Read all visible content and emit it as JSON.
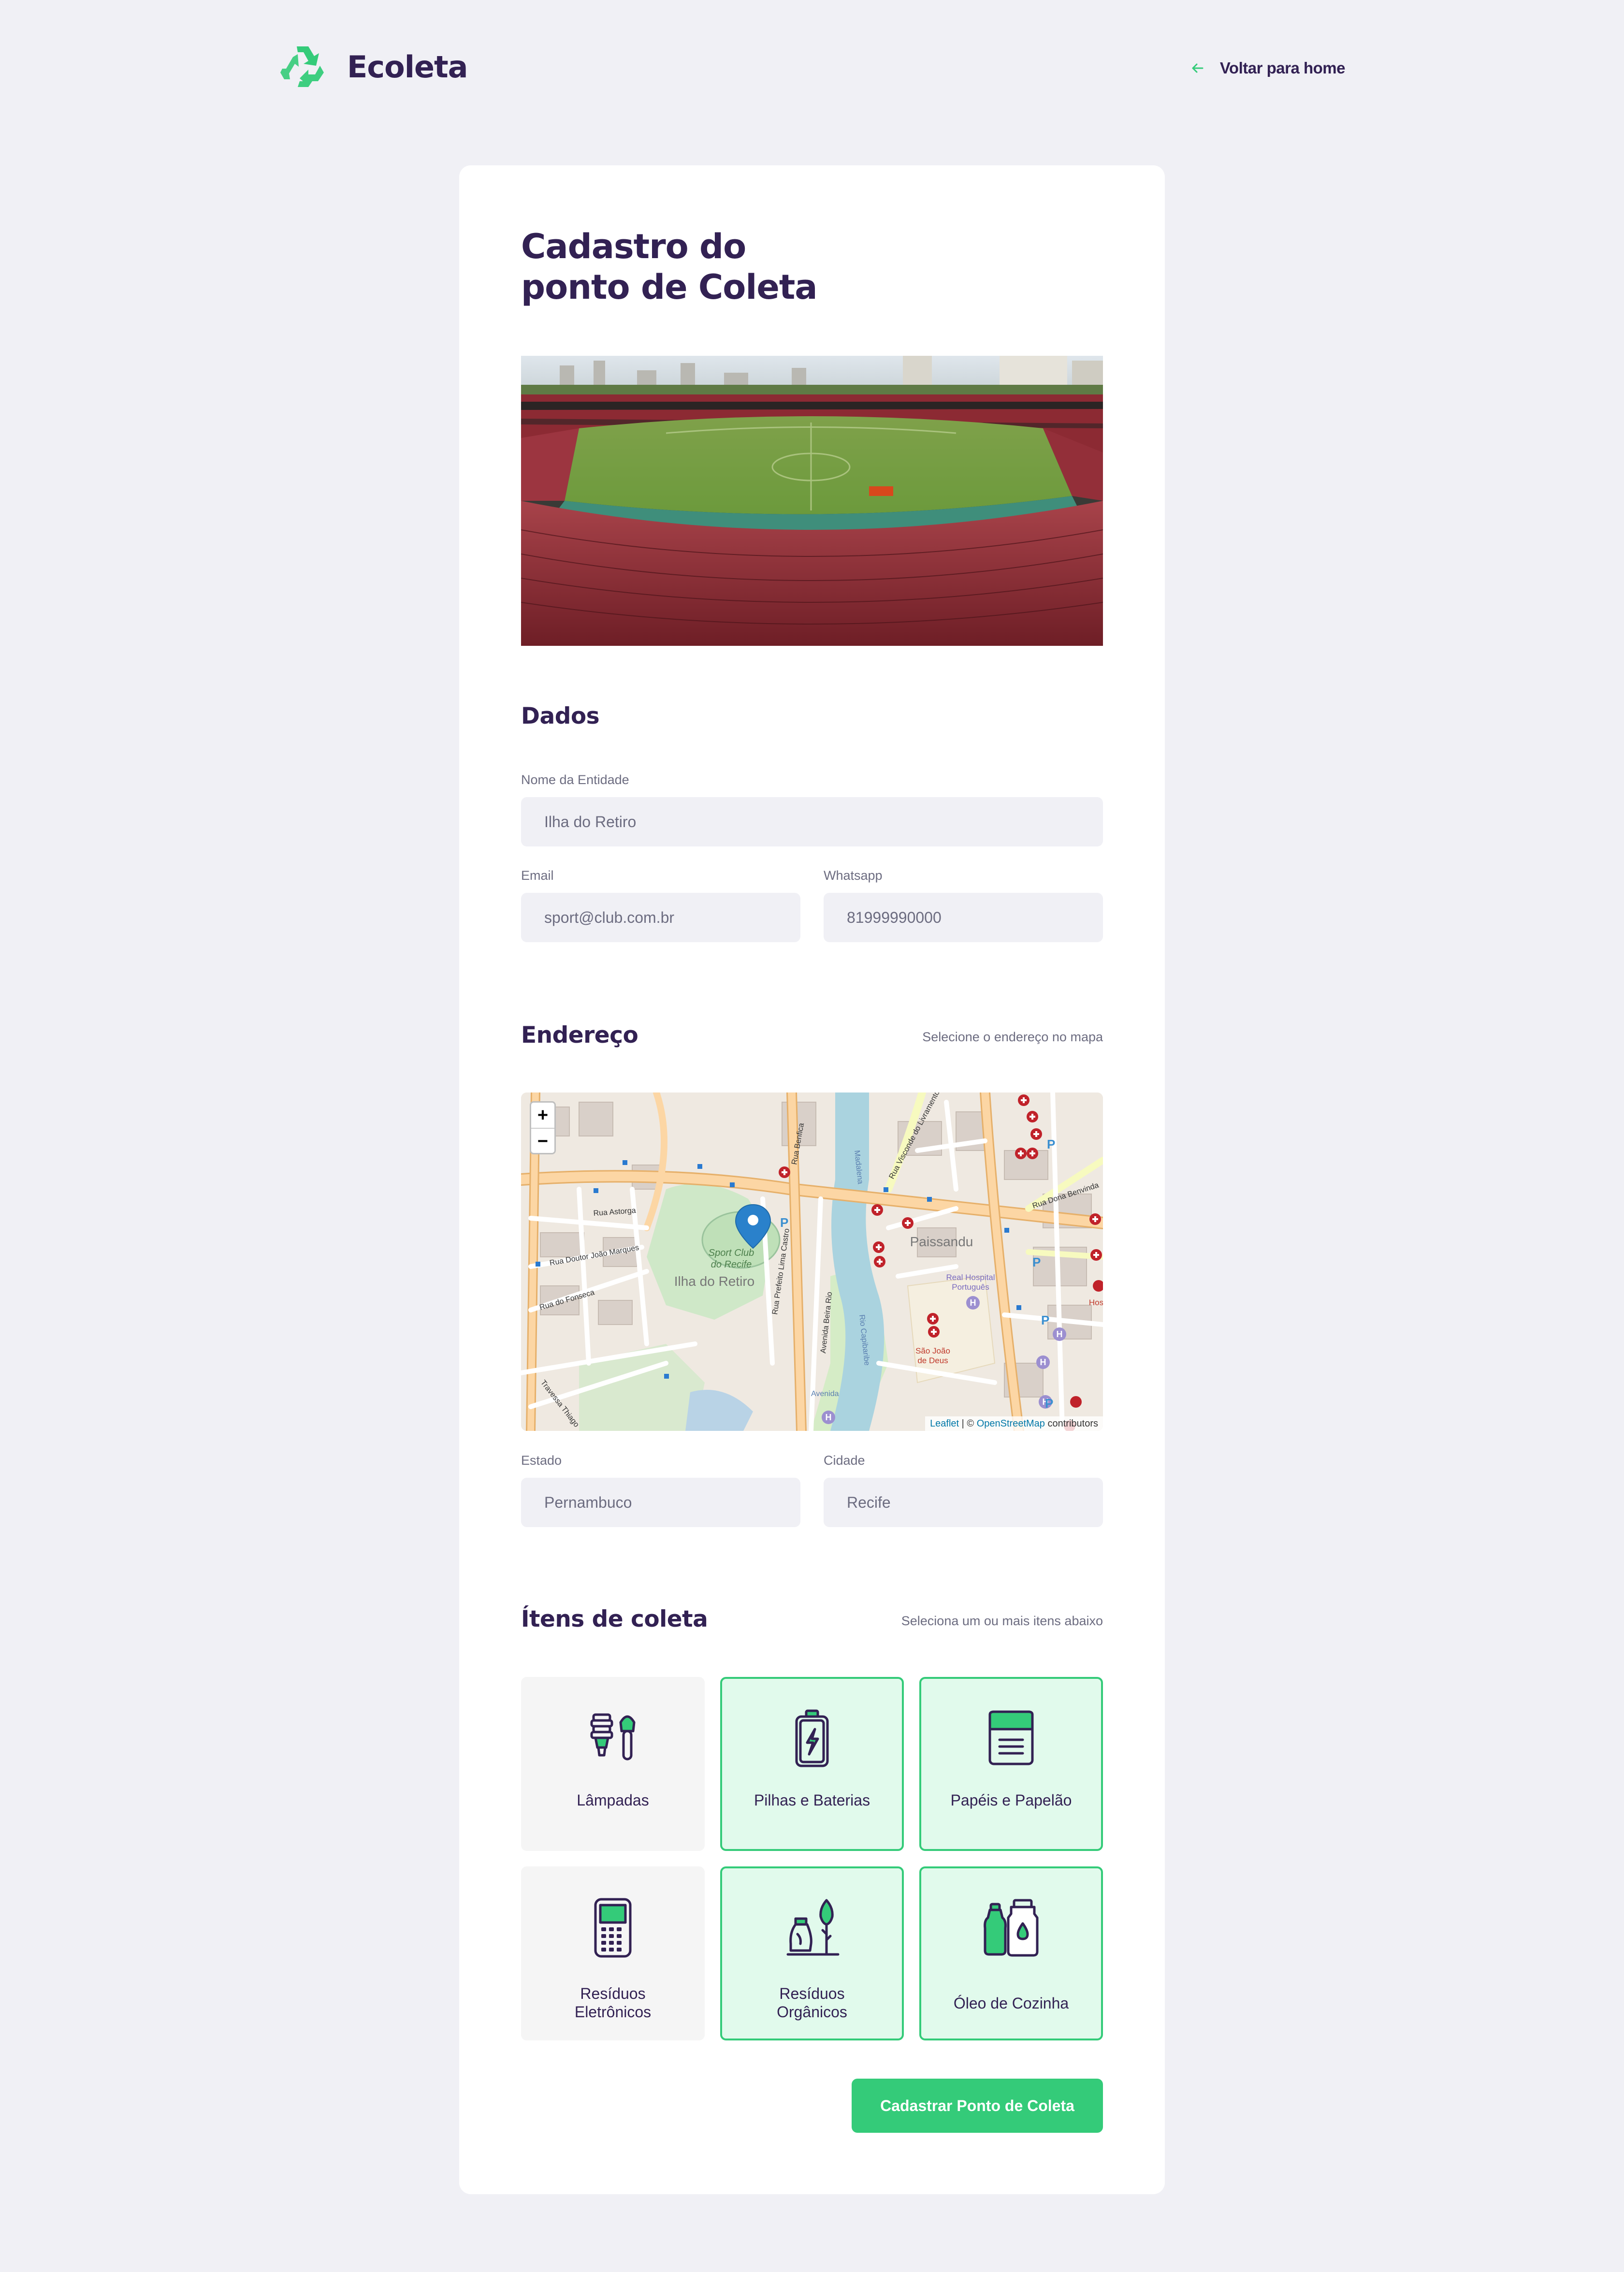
{
  "header": {
    "logo_icon": "recycle-icon",
    "logo_text": "Ecoleta",
    "back_icon": "arrow-left-icon",
    "back_label": "Voltar para home"
  },
  "form": {
    "title_line1": "Cadastro do",
    "title_line2": "ponto de Coleta",
    "image_alt": "stadium-photo"
  },
  "dados": {
    "title": "Dados",
    "name": {
      "label": "Nome da Entidade",
      "value": "Ilha do Retiro"
    },
    "email": {
      "label": "Email",
      "value": "sport@club.com.br"
    },
    "whatsapp": {
      "label": "Whatsapp",
      "value": "81999990000"
    }
  },
  "endereco": {
    "title": "Endereço",
    "hint": "Selecione o endereço no mapa",
    "map": {
      "zoom_in": "+",
      "zoom_out": "−",
      "attribution_leaflet": "Leaflet",
      "attribution_sep": " | © ",
      "attribution_osm": "OpenStreetMap",
      "attribution_tail": " contributors",
      "labels": {
        "rua_astorga": "Rua Astorga",
        "rua_doutor": "Rua Doutor João Marques",
        "rua_fonseca": "Rua do Fonseca",
        "sport_club": "Sport Club",
        "do_recife": "do Recife",
        "ilha": "Ilha do Retiro",
        "paissandu": "Paissandu",
        "real_hospital": "Real Hospital",
        "portugues": "Português",
        "sao_joao": "São João",
        "de_deus": "de Deus",
        "rua_dona": "Rua Dona Benvinda",
        "av_beira_rio": "Avenida Beira Rio",
        "rua_prefeito": "Rua Prefeito Lima Castro",
        "rio_capibaribe": "Rio Capibaribe",
        "rua_visconde": "Rua Visconde do Livramento",
        "travessa": "Travessa Thiago",
        "avenida": "Avenida",
        "hos": "Hos",
        "rua_benfica": "Rua Benfica",
        "madalena": "Madalena"
      }
    },
    "estado": {
      "label": "Estado",
      "value": "Pernambuco"
    },
    "cidade": {
      "label": "Cidade",
      "value": "Recife"
    }
  },
  "itens": {
    "title": "Ítens de coleta",
    "hint": "Seleciona um ou mais itens abaixo",
    "list": [
      {
        "label": "Lâmpadas",
        "icon": "lamps-icon",
        "selected": false
      },
      {
        "label": "Pilhas e Baterias",
        "icon": "battery-icon",
        "selected": true
      },
      {
        "label": "Papéis e Papelão",
        "icon": "paper-icon",
        "selected": true
      },
      {
        "label_line1": "Resíduos",
        "label_line2": "Eletrônicos",
        "icon": "electronics-icon",
        "selected": false
      },
      {
        "label_line1": "Resíduos",
        "label_line2": "Orgânicos",
        "icon": "organic-icon",
        "selected": true
      },
      {
        "label": "Óleo de Cozinha",
        "icon": "oil-icon",
        "selected": true
      }
    ]
  },
  "submit_label": "Cadastrar Ponto de Coleta",
  "colors": {
    "primary": "#34cb79",
    "title": "#322153",
    "text": "#6c6c80",
    "background": "#f0f0f5",
    "selected_bg": "#e1faec"
  }
}
